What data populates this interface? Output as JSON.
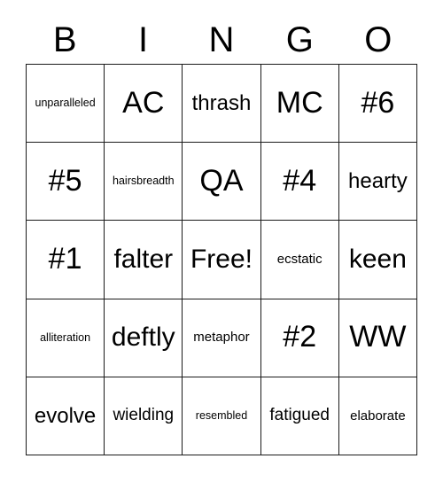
{
  "card": {
    "type": "bingo-card",
    "columns": 5,
    "rows": 5,
    "free_space_label": "Free!",
    "free_space_position": {
      "row": 3,
      "column": 3
    },
    "colors": {
      "background": "#ffffff",
      "grid_line": "#1a1a1a",
      "text": "#000000"
    }
  },
  "header": {
    "letters": [
      {
        "label": "B"
      },
      {
        "label": "I"
      },
      {
        "label": "N"
      },
      {
        "label": "G"
      },
      {
        "label": "O"
      }
    ]
  },
  "grid": {
    "rows": [
      {
        "cells": [
          {
            "label": "unparalleled",
            "size": "xxs"
          },
          {
            "label": "AC",
            "size": "xl"
          },
          {
            "label": "thrash",
            "size": "md"
          },
          {
            "label": "MC",
            "size": "xl"
          },
          {
            "label": "#6",
            "size": "xl"
          }
        ]
      },
      {
        "cells": [
          {
            "label": "#5",
            "size": "xl"
          },
          {
            "label": "hairsbreadth",
            "size": "xxs"
          },
          {
            "label": "QA",
            "size": "xl"
          },
          {
            "label": "#4",
            "size": "xl"
          },
          {
            "label": "hearty",
            "size": "md"
          }
        ]
      },
      {
        "cells": [
          {
            "label": "#1",
            "size": "xl"
          },
          {
            "label": "falter",
            "size": "lg"
          },
          {
            "label": "Free!",
            "size": "lg"
          },
          {
            "label": "ecstatic",
            "size": "xs"
          },
          {
            "label": "keen",
            "size": "lg"
          }
        ]
      },
      {
        "cells": [
          {
            "label": "alliteration",
            "size": "xxs"
          },
          {
            "label": "deftly",
            "size": "lg"
          },
          {
            "label": "metaphor",
            "size": "xs"
          },
          {
            "label": "#2",
            "size": "xl"
          },
          {
            "label": "WW",
            "size": "xl"
          }
        ]
      },
      {
        "cells": [
          {
            "label": "evolve",
            "size": "md"
          },
          {
            "label": "wielding",
            "size": "sm"
          },
          {
            "label": "resembled",
            "size": "xxs"
          },
          {
            "label": "fatigued",
            "size": "sm"
          },
          {
            "label": "elaborate",
            "size": "xs"
          }
        ]
      }
    ]
  }
}
